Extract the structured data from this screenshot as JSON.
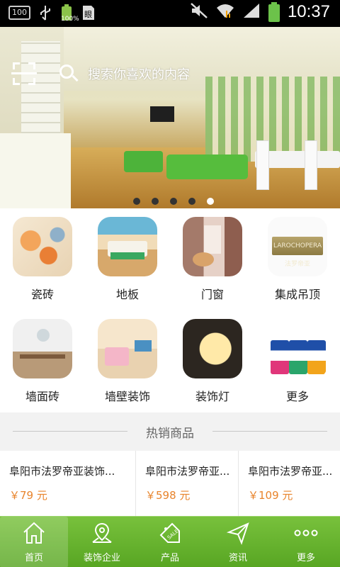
{
  "status_bar": {
    "signal_label": "100",
    "battery_small_pct": "100%",
    "time": "10:37"
  },
  "banner": {
    "search_placeholder": "搜索你喜欢的内容",
    "slide_count": 5,
    "active_slide": 5
  },
  "categories": [
    {
      "label": "瓷砖",
      "icon": "ceramic-tile-image"
    },
    {
      "label": "地板",
      "icon": "floor-image"
    },
    {
      "label": "门窗",
      "icon": "door-window-image"
    },
    {
      "label": "集成吊顶",
      "icon": "ceiling-image"
    },
    {
      "label": "墙面砖",
      "icon": "wall-tile-image"
    },
    {
      "label": "墙壁装饰",
      "icon": "wall-decor-image"
    },
    {
      "label": "装饰灯",
      "icon": "lamp-image"
    },
    {
      "label": "更多",
      "icon": "more-image"
    }
  ],
  "ceiling_plate_text": "LAROCHOPERA 法罗帝亚",
  "hot": {
    "title": "热销商品"
  },
  "products": [
    {
      "name": "阜阳市法罗帝亚装饰...",
      "price": "￥79 元"
    },
    {
      "name": "阜阳市法罗帝亚...",
      "price": "￥598 元"
    },
    {
      "name": "阜阳市法罗帝亚...",
      "price": "￥109 元"
    }
  ],
  "tabbar": {
    "tabs": [
      {
        "label": "首页",
        "icon": "home-icon"
      },
      {
        "label": "装饰企业",
        "icon": "map-pin-icon"
      },
      {
        "label": "产品",
        "icon": "sale-tag-icon"
      },
      {
        "label": "资讯",
        "icon": "send-icon"
      },
      {
        "label": "更多",
        "icon": "more-dots-icon"
      }
    ]
  },
  "colors": {
    "accent_green": "#5faf28",
    "price_orange": "#e8842c"
  }
}
